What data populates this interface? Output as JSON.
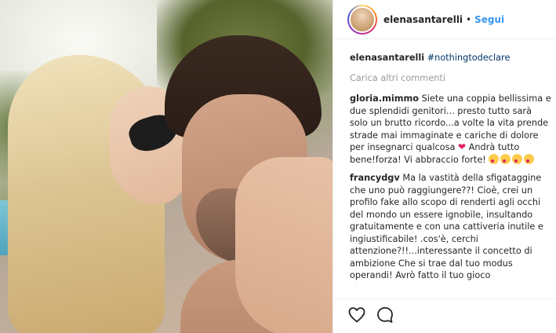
{
  "post": {
    "username": "elenasantarelli",
    "separator": "•",
    "follow_label": "Segui"
  },
  "caption": {
    "username": "elenasantarelli",
    "hashtag": "#nothingtodeclare"
  },
  "load_more": "Carica altri commenti",
  "comments": [
    {
      "username": "gloria.mimmo",
      "text_before_heart": " Siete una coppia bellissima e due splendidi genitori... presto tutto sarà solo un brutto ricordo...a volte la vita prende strade mai immaginate e cariche di dolore per insegnarci qualcosa ",
      "heart": "❤",
      "text_after_heart": " Andrà tutto bene!forza! Vi abbraccio forte! ",
      "emoji_count": 4
    },
    {
      "username": "francydgv",
      "text": " Ma la vastità della sfigataggine che uno può raggiungere??! Cioè, crei un profilo fake allo scopo di renderti agli occhi del mondo un essere ignobile, insultando gratuitamente e con una cattiveria inutile e ingiustificabile! .cos'è, cerchi attenzione?!!...interessante il concetto di ambizione Che si trae dal tuo modus operandi! Avrò fatto il tuo gioco"
    }
  ],
  "icons": {
    "like": "heart-outline-icon",
    "comment": "speech-bubble-icon"
  },
  "colors": {
    "link_blue": "#3897f0",
    "hashtag": "#003569",
    "muted": "#999999",
    "heart_red": "#e0245e"
  }
}
